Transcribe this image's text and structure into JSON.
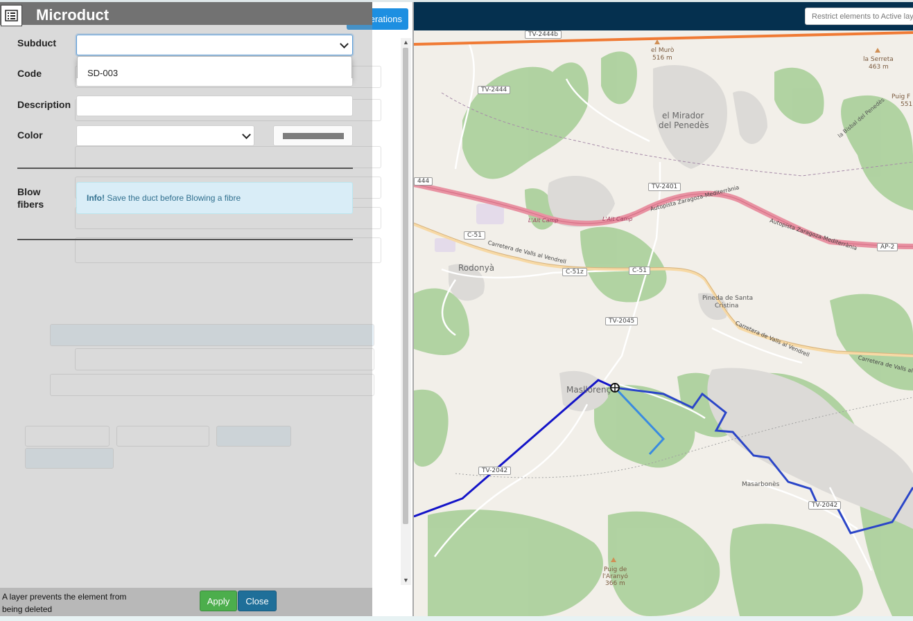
{
  "dialog": {
    "title": "Microduct",
    "fields": {
      "subduct_label": "Subduct",
      "subduct_dropdown_option": "SD-003",
      "code_label": "Code",
      "description_label": "Description",
      "color_label": "Color",
      "blow_fibers_label_1": "Blow",
      "blow_fibers_label_2": "fibers"
    },
    "info": {
      "strong": "Info!",
      "text": "Save the duct before Blowing a fibre"
    },
    "footer": {
      "message": "A layer prevents the element from being deleted",
      "apply_label": "Apply",
      "close_label": "Close"
    }
  },
  "background_panel": {
    "operations_label": "Operations"
  },
  "map_topbar": {
    "restrict_placeholder": "Restrict elements to Active layers"
  },
  "map": {
    "labels": {
      "el_muro": "el Murò",
      "el_muro_height": "516 m",
      "la_serreta": "la Serreta",
      "la_serreta_height": "463 m",
      "puig_f": "Puig F",
      "puig_f_height": "551",
      "el_mirador_1": "el Mirador",
      "el_mirador_2": "del Penedès",
      "rodonya": "Rodonyà",
      "pineda_1": "Pineda de Santa",
      "pineda_2": "Cristina",
      "masllorenc": "Masllorenç",
      "masarbones": "Masarbonès",
      "puig_aranyo_1": "Puig de",
      "puig_aranyo_2": "l'Aranyó",
      "puig_aranyo_height": "366 m",
      "la_bisbal": "la Bisbal del Penedès",
      "autopista_1": "Autopista Zaragoza-Mediterrània",
      "autopista_2": "Autopista Zaragoza-Mediterrània",
      "alt_camp_1": "L'Alt Camp",
      "alt_camp_2": "L'Alt Camp",
      "carretera_1": "Carretera de Valls al Vendrell",
      "carretera_2": "Carretera de Valls al Vendrell",
      "carretera_3": "Carretera de Valls al"
    },
    "road_tags": {
      "tv2444b": "TV-2444b",
      "tv2444": "TV-2444",
      "tv2401": "TV-2401",
      "c51a": "C-51",
      "c51z": "C-51z",
      "c51b": "C-51",
      "tv2045": "TV-2045",
      "tv2042a": "TV-2042",
      "tv2042b": "TV-2042",
      "ap2": "AP-2",
      "n444": "444"
    }
  }
}
